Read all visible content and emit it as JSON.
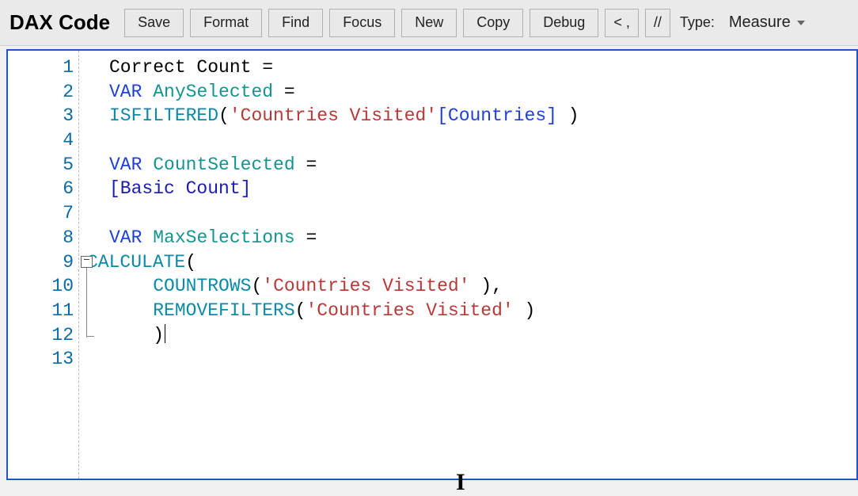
{
  "header": {
    "title": "DAX Code",
    "buttons": {
      "save": "Save",
      "format": "Format",
      "find": "Find",
      "focus": "Focus",
      "new": "New",
      "copy": "Copy",
      "debug": "Debug",
      "back": "< ,",
      "comment": "//"
    },
    "type_label": "Type:",
    "type_value": "Measure"
  },
  "editor": {
    "line_numbers": [
      "1",
      "2",
      "3",
      "4",
      "5",
      "6",
      "7",
      "8",
      "9",
      "10",
      "11",
      "12",
      "13"
    ],
    "lines": [
      {
        "tokens": [
          {
            "t": "Correct Count ",
            "c": ""
          },
          {
            "t": "=",
            "c": ""
          }
        ]
      },
      {
        "tokens": [
          {
            "t": "VAR",
            "c": "kw-var"
          },
          {
            "t": " ",
            "c": ""
          },
          {
            "t": "AnySelected",
            "c": "identifier"
          },
          {
            "t": " =",
            "c": ""
          }
        ]
      },
      {
        "tokens": [
          {
            "t": "ISFILTERED",
            "c": "kw-func"
          },
          {
            "t": "(",
            "c": ""
          },
          {
            "t": "'Countries Visited'",
            "c": "string"
          },
          {
            "t": "[Countries]",
            "c": "colref"
          },
          {
            "t": " )",
            "c": ""
          }
        ]
      },
      {
        "tokens": []
      },
      {
        "tokens": [
          {
            "t": "VAR",
            "c": "kw-var"
          },
          {
            "t": " ",
            "c": ""
          },
          {
            "t": "CountSelected",
            "c": "identifier"
          },
          {
            "t": " =",
            "c": ""
          }
        ]
      },
      {
        "tokens": [
          {
            "t": "[Basic Count]",
            "c": "measure"
          }
        ]
      },
      {
        "tokens": []
      },
      {
        "tokens": [
          {
            "t": "VAR",
            "c": "kw-var"
          },
          {
            "t": " ",
            "c": ""
          },
          {
            "t": "MaxSelections",
            "c": "identifier"
          },
          {
            "t": " =",
            "c": ""
          }
        ]
      },
      {
        "tokens": [
          {
            "t": "CALCULATE",
            "c": "kw-func"
          },
          {
            "t": "(",
            "c": ""
          }
        ],
        "fold_start": true,
        "dedent": true
      },
      {
        "tokens": [
          {
            "t": "    ",
            "c": ""
          },
          {
            "t": "COUNTROWS",
            "c": "kw-func"
          },
          {
            "t": "(",
            "c": ""
          },
          {
            "t": "'Countries Visited'",
            "c": "string"
          },
          {
            "t": " ),",
            "c": ""
          }
        ],
        "fold_mid": true
      },
      {
        "tokens": [
          {
            "t": "    ",
            "c": ""
          },
          {
            "t": "REMOVEFILTERS",
            "c": "kw-func"
          },
          {
            "t": "(",
            "c": ""
          },
          {
            "t": "'Countries Visited'",
            "c": "string"
          },
          {
            "t": " )",
            "c": ""
          }
        ],
        "fold_mid": true
      },
      {
        "tokens": [
          {
            "t": "    )",
            "c": ""
          }
        ],
        "fold_end": true,
        "cursor_after": true
      },
      {
        "tokens": []
      }
    ]
  }
}
